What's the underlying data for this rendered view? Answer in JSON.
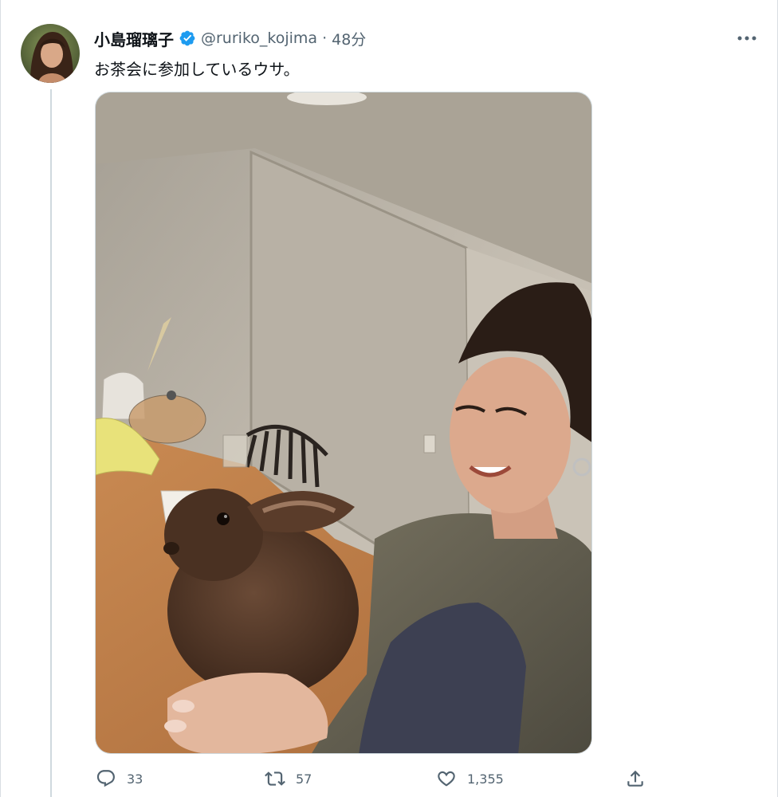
{
  "tweet": {
    "author_name": "小島瑠璃子",
    "handle": "@ruriko_kojima",
    "separator": "·",
    "time": "48分",
    "text": "お茶会に参加しているウサ。",
    "verified": true
  },
  "actions": {
    "reply_count": "33",
    "retweet_count": "57",
    "like_count": "1,355"
  },
  "icons": {
    "verified": "verified-badge-icon",
    "more": "more-icon",
    "reply": "reply-icon",
    "retweet": "retweet-icon",
    "like": "like-icon",
    "share": "share-icon"
  },
  "colors": {
    "verified_blue": "#1d9bf0",
    "secondary_text": "#536471",
    "primary_text": "#0f1419"
  }
}
